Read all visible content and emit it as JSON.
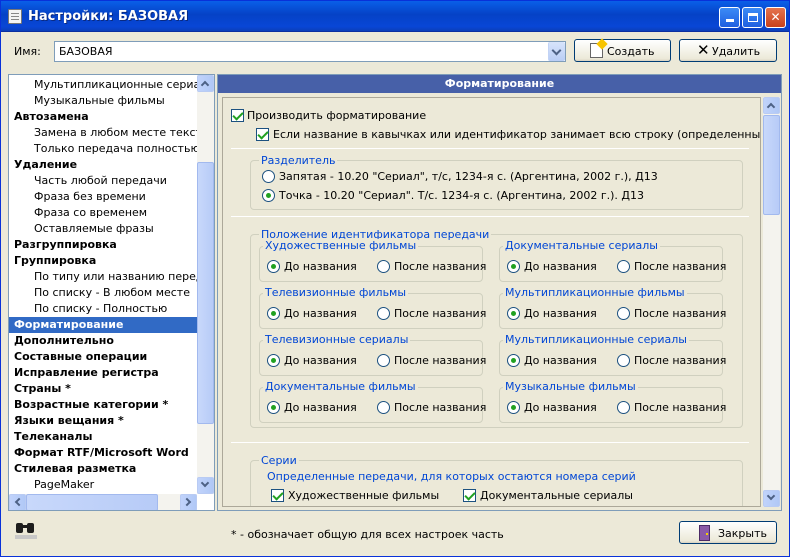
{
  "window": {
    "title": "Настройки: БАЗОВАЯ"
  },
  "top": {
    "name_label": "Имя:",
    "name_value": "БАЗОВАЯ",
    "create_label": "Создать",
    "delete_label": "Удалить"
  },
  "tree": [
    {
      "label": "Мультипликационные сериалы",
      "type": "sub"
    },
    {
      "label": "Музыкальные фильмы",
      "type": "sub"
    },
    {
      "label": "Автозамена",
      "type": "cat"
    },
    {
      "label": "Замена в любом месте текста",
      "type": "sub"
    },
    {
      "label": "Только передача полностью",
      "type": "sub"
    },
    {
      "label": "Удаление",
      "type": "cat"
    },
    {
      "label": "Часть любой передачи",
      "type": "sub"
    },
    {
      "label": "Фраза без времени",
      "type": "sub"
    },
    {
      "label": "Фраза со временем",
      "type": "sub"
    },
    {
      "label": "Оставляемые фразы",
      "type": "sub"
    },
    {
      "label": "Разгруппировка",
      "type": "cat"
    },
    {
      "label": "Группировка",
      "type": "cat"
    },
    {
      "label": "По типу или названию передачи",
      "type": "sub"
    },
    {
      "label": "По списку - В любом месте",
      "type": "sub"
    },
    {
      "label": "По списку - Полностью",
      "type": "sub"
    },
    {
      "label": "Форматирование",
      "type": "cat",
      "selected": true
    },
    {
      "label": "Дополнительно",
      "type": "cat"
    },
    {
      "label": "Составные операции",
      "type": "cat"
    },
    {
      "label": "Исправление регистра",
      "type": "cat"
    },
    {
      "label": "Страны *",
      "type": "cat"
    },
    {
      "label": "Возрастные категории *",
      "type": "cat"
    },
    {
      "label": "Языки вещания *",
      "type": "cat"
    },
    {
      "label": "Телеканалы",
      "type": "cat"
    },
    {
      "label": "Формат RTF/Microsoft Word",
      "type": "cat"
    },
    {
      "label": "Стилевая разметка",
      "type": "cat"
    },
    {
      "label": "PageMaker",
      "type": "sub"
    }
  ],
  "panel": {
    "header": "Форматирование",
    "do_format": {
      "label": "Производить форматирование",
      "checked": true
    },
    "full_line": {
      "label": "Если название в кавычках или идентификатор занимает всю строку (определенные передачи)",
      "checked": true
    },
    "separator": {
      "title": "Разделитель",
      "options": [
        {
          "label": "Запятая   - 10.20 \"Сериал\", т/с, 1234-я с. (Аргентина, 2002 г.), Д13",
          "selected": false
        },
        {
          "label": "Точка   - 10.20 \"Сериал\". Т/с. 1234-я с. (Аргентина, 2002 г.). Д13",
          "selected": true
        }
      ]
    },
    "id_position": {
      "title": "Положение идентификатора передачи",
      "before_label": "До названия",
      "after_label": "После названия",
      "groups": [
        {
          "title": "Художественные фильмы",
          "value": "before"
        },
        {
          "title": "Документальные сериалы",
          "value": "before"
        },
        {
          "title": "Телевизионные фильмы",
          "value": "before"
        },
        {
          "title": "Мультипликационные фильмы",
          "value": "before"
        },
        {
          "title": "Телевизионные сериалы",
          "value": "before"
        },
        {
          "title": "Мультипликационные сериалы",
          "value": "before"
        },
        {
          "title": "Документальные фильмы",
          "value": "before"
        },
        {
          "title": "Музыкальные фильмы",
          "value": "before"
        }
      ]
    },
    "series": {
      "title": "Серии",
      "subtitle": "Определенные передачи, для которых остаются номера серий",
      "items": [
        {
          "label": "Художественные фильмы",
          "checked": true
        },
        {
          "label": "Документальные сериалы",
          "checked": true
        }
      ]
    }
  },
  "footer": {
    "note": "* - обозначает общую для всех настроек часть",
    "close_label": "Закрыть"
  }
}
